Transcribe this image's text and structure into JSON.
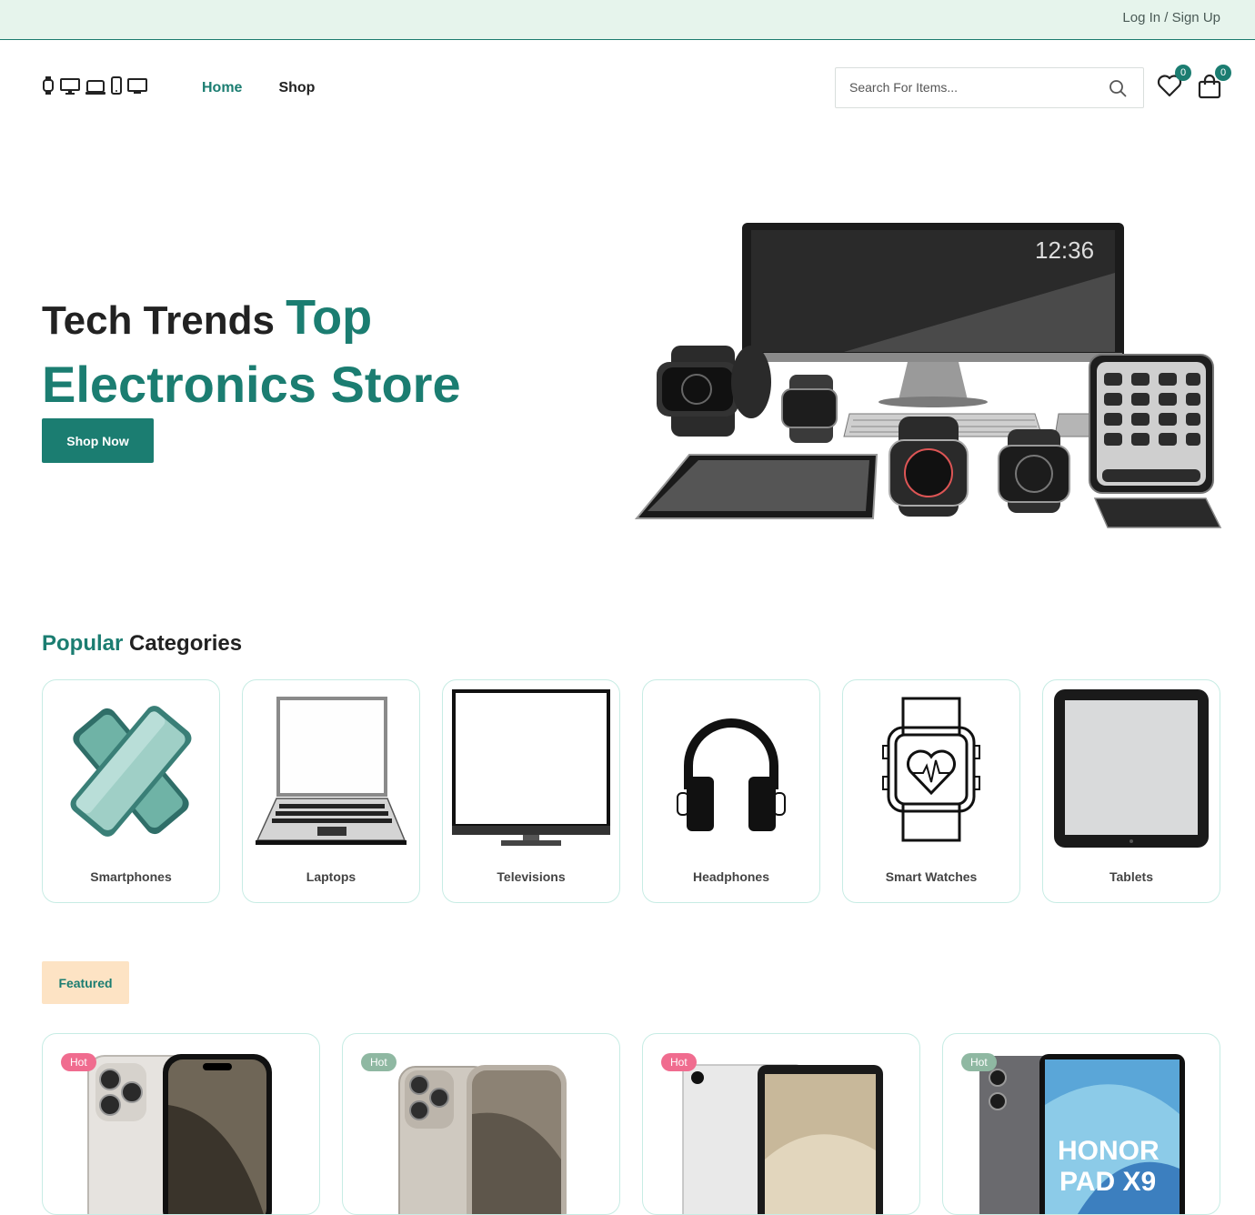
{
  "topbar": {
    "login_label": "Log In / Sign Up"
  },
  "header": {
    "logo_icons": [
      "watch-icon",
      "desktop-icon",
      "laptop-icon",
      "phone-icon",
      "monitor-icon"
    ],
    "nav": [
      {
        "label": "Home",
        "active": true
      },
      {
        "label": "Shop",
        "active": false
      }
    ],
    "search_placeholder": "Search For Items...",
    "wishlist_count": "0",
    "cart_count": "0"
  },
  "hero": {
    "title_part1": "Tech Trends ",
    "title_part2": "Top",
    "title_line2": "Electronics Store",
    "button_label": "Shop Now",
    "screen_time": "12:36"
  },
  "categories": {
    "heading_accent": "Popular",
    "heading_rest": " Categories",
    "items": [
      {
        "label": "Smartphones"
      },
      {
        "label": "Laptops"
      },
      {
        "label": "Televisions"
      },
      {
        "label": "Headphones"
      },
      {
        "label": "Smart Watches"
      },
      {
        "label": "Tablets"
      }
    ]
  },
  "products": {
    "tab_label": "Featured",
    "items": [
      {
        "badge": "Hot",
        "badge_color": "#f06c8f"
      },
      {
        "badge": "Hot",
        "badge_color": "#8fb8a2"
      },
      {
        "badge": "Hot",
        "badge_color": "#f06c8f"
      },
      {
        "badge": "Hot",
        "badge_color": "#8fb8a2"
      }
    ],
    "honor_text1": "HONOR",
    "honor_text2": "PAD X9"
  },
  "colors": {
    "accent": "#1b7d71",
    "topbar_bg": "#e6f4ec",
    "featured_bg": "#fde3c4"
  }
}
